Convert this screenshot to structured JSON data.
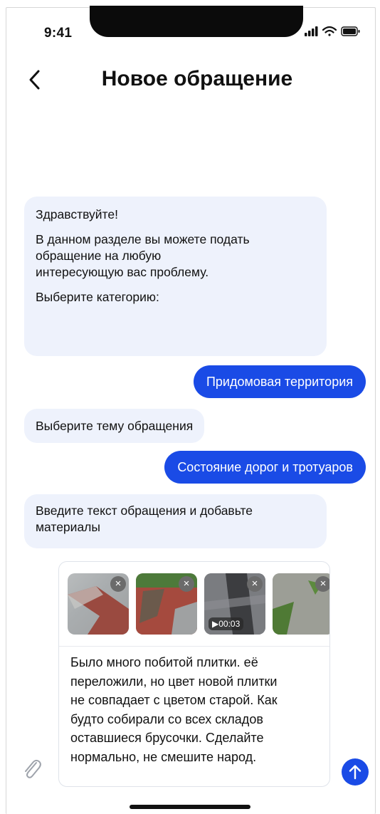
{
  "status_bar": {
    "time": "9:41"
  },
  "header": {
    "title": "Новое обращение"
  },
  "messages": [
    {
      "from": "bot",
      "lines": [
        "Здравствуйте!",
        "",
        "В данном разделе вы можете подать",
        "обращение на любую",
        "интересующую вас проблему.",
        "",
        "Выберите категорию:"
      ]
    },
    {
      "from": "user",
      "text": "Придомовая территория"
    },
    {
      "from": "bot",
      "text": "Выберите тему обращения"
    },
    {
      "from": "user",
      "text": "Состояние дорог и тротуаров"
    },
    {
      "from": "bot",
      "lines": [
        "Введите текст обращения и добавьте",
        "материалы"
      ]
    }
  ],
  "composer": {
    "attachments": [
      {
        "type": "photo",
        "icon": "photo-thumbnail"
      },
      {
        "type": "photo",
        "icon": "photo-thumbnail"
      },
      {
        "type": "video",
        "icon": "video-thumbnail",
        "duration": "00:03"
      },
      {
        "type": "photo",
        "icon": "photo-thumbnail"
      }
    ],
    "remove_glyph": "×",
    "play_glyph": "▶",
    "text_lines": [
      "Было много побитой плитки. её",
      "переложили, но цвет новой плитки",
      "не совпадает с цветом старой. Как",
      "будто собирали со всех складов",
      "оставшиеся брусочки. Сделайте",
      "нормально, не смешите народ."
    ]
  },
  "colors": {
    "accent": "#1a4be6",
    "bot_bubble": "#eef2fc"
  }
}
